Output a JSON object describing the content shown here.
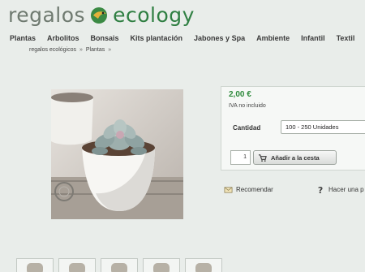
{
  "logo": {
    "word1": "regalos",
    "word2": "ecology"
  },
  "nav": [
    "Plantas",
    "Arbolitos",
    "Bonsais",
    "Kits plantación",
    "Jabones y Spa",
    "Ambiente",
    "Infantil",
    "Textil"
  ],
  "breadcrumb": [
    "regalos ecológicos",
    "Plantas"
  ],
  "breadcrumb_sep": "»",
  "product": {
    "price": "2,00 €",
    "tax_note": "IVA no incluido",
    "quantity_label": "Cantidad",
    "quantity_option": "100 - 250 Unidades",
    "quantity_value": "1",
    "add_to_cart": "Añadir a la cesta"
  },
  "actions": {
    "recommend": "Recomendar",
    "ask": "Hacer una p"
  },
  "colors": {
    "brand_green": "#2f7f42",
    "price_green": "#2f8a3c",
    "background": "#e9edea"
  }
}
